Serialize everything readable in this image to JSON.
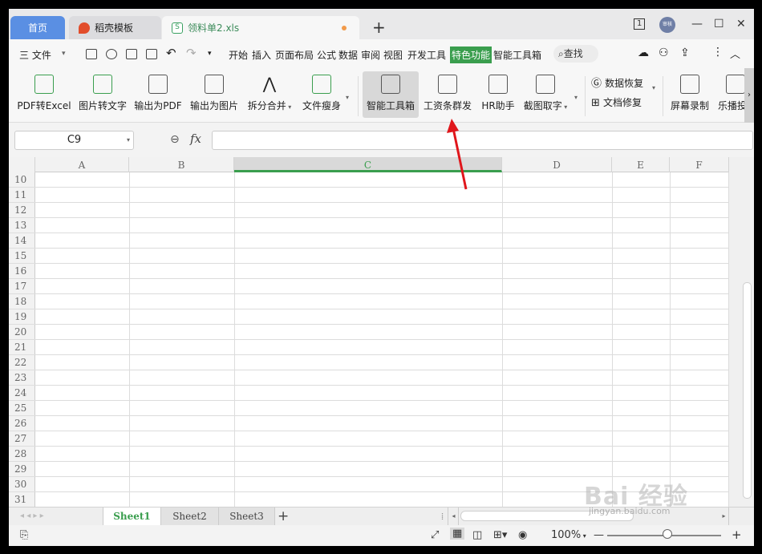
{
  "tabs": {
    "home": "首页",
    "template": "稻壳模板",
    "file": "领料单2.xls",
    "file_icon": "S",
    "add": "+"
  },
  "window": {
    "badge": "1",
    "avatar": "审核",
    "minimize": "—",
    "maximize": "☐",
    "close": "✕"
  },
  "menu": {
    "file": "三 文件",
    "items": [
      "开始",
      "插入",
      "页面布局",
      "公式",
      "数据",
      "审阅",
      "视图",
      "开发工具"
    ],
    "active": "特色功能",
    "after": "智能工具箱",
    "search": "查找"
  },
  "ribbon": {
    "buttons": [
      "PDF转Excel",
      "图片转文字",
      "输出为PDF",
      "输出为图片",
      "拆分合并",
      "文件瘦身",
      "智能工具箱",
      "工资条群发",
      "HR助手",
      "截图取字"
    ],
    "data_recover": "数据恢复",
    "doc_repair": "文档修复",
    "screen_record": "屏幕录制",
    "lebo": "乐播投"
  },
  "formula": {
    "cell_ref": "C9",
    "fx": "fx",
    "value": ""
  },
  "columns": [
    "A",
    "B",
    "C",
    "D",
    "E",
    "F"
  ],
  "rows": [
    "10",
    "11",
    "12",
    "13",
    "14",
    "15",
    "16",
    "17",
    "18",
    "19",
    "20",
    "21",
    "22",
    "23",
    "24",
    "25",
    "26",
    "27",
    "28",
    "29",
    "30",
    "31"
  ],
  "sheets": [
    "Sheet1",
    "Sheet2",
    "Sheet3"
  ],
  "status": {
    "zoom": "100%",
    "zoom_minus": "—",
    "zoom_plus": "+"
  },
  "watermark": {
    "text": "Bai 经验",
    "url": "jingyan.baidu.com"
  }
}
